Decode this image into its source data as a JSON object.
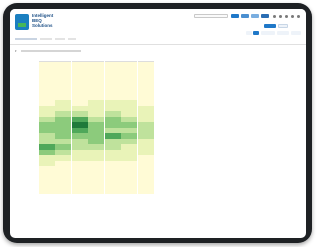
{
  "app": {
    "logo_lines": [
      "Intelligent",
      "BEQ",
      "Solutions"
    ]
  },
  "topbar": {
    "search_placeholder": "",
    "buttons": [
      {
        "label": "",
        "color": "#1f78c8"
      },
      {
        "label": "",
        "color": "#4a8fd0"
      },
      {
        "label": "",
        "color": "#7aaee0"
      },
      {
        "label": "",
        "color": "#2a6db3"
      }
    ]
  },
  "subnav": {
    "items": [
      {
        "label": ""
      },
      {
        "label": ""
      },
      {
        "label": ""
      },
      {
        "label": ""
      }
    ]
  },
  "panel": {
    "title": ""
  },
  "heatmap": {
    "columns": [
      "",
      "",
      "",
      "",
      "",
      "",
      ""
    ],
    "rows": [
      {
        "label": "",
        "values": [
          0,
          0,
          0,
          0,
          0,
          0,
          0
        ]
      },
      {
        "label": "",
        "values": [
          0,
          0,
          0,
          0,
          0,
          0,
          0
        ]
      },
      {
        "label": "",
        "values": [
          0,
          0,
          0,
          0,
          0,
          0,
          0
        ]
      },
      {
        "label": "",
        "values": [
          0,
          0,
          0,
          0,
          0,
          0,
          0
        ]
      },
      {
        "label": "",
        "values": [
          0,
          0,
          0,
          0,
          0,
          0,
          0
        ]
      },
      {
        "label": "",
        "values": [
          0,
          0,
          0,
          0,
          0,
          0,
          0
        ]
      },
      {
        "label": "",
        "values": [
          0,
          0,
          0,
          0,
          0,
          0,
          0
        ]
      },
      {
        "label": "",
        "values": [
          0,
          1,
          0,
          1,
          1,
          1,
          0
        ]
      },
      {
        "label": "",
        "values": [
          1,
          1,
          1,
          1,
          1,
          1,
          1
        ]
      },
      {
        "label": "",
        "values": [
          1,
          2,
          2,
          1,
          2,
          1,
          1
        ]
      },
      {
        "label": "",
        "values": [
          2,
          3,
          4,
          2,
          3,
          2,
          1
        ]
      },
      {
        "label": "",
        "values": [
          3,
          3,
          5,
          3,
          3,
          3,
          2
        ]
      },
      {
        "label": "",
        "values": [
          3,
          3,
          4,
          3,
          2,
          2,
          2
        ]
      },
      {
        "label": "",
        "values": [
          2,
          3,
          3,
          3,
          4,
          3,
          2
        ]
      },
      {
        "label": "",
        "values": [
          2,
          2,
          2,
          3,
          2,
          2,
          1
        ]
      },
      {
        "label": "",
        "values": [
          4,
          3,
          2,
          2,
          2,
          1,
          1
        ]
      },
      {
        "label": "",
        "values": [
          3,
          2,
          1,
          1,
          1,
          1,
          1
        ]
      },
      {
        "label": "",
        "values": [
          1,
          1,
          1,
          1,
          1,
          1,
          0
        ]
      },
      {
        "label": "",
        "values": [
          1,
          0,
          0,
          0,
          0,
          0,
          0
        ]
      },
      {
        "label": "",
        "values": [
          0,
          0,
          0,
          0,
          0,
          0,
          0
        ]
      },
      {
        "label": "",
        "values": [
          0,
          0,
          0,
          0,
          0,
          0,
          0
        ]
      },
      {
        "label": "",
        "values": [
          0,
          0,
          0,
          0,
          0,
          0,
          0
        ]
      },
      {
        "label": "",
        "values": [
          0,
          0,
          0,
          0,
          0,
          0,
          0
        ]
      },
      {
        "label": "",
        "values": [
          0,
          0,
          0,
          0,
          0,
          0,
          0
        ]
      }
    ],
    "scale": [
      "#fffbd6",
      "#e9f3b8",
      "#bfe29c",
      "#8ccb7c",
      "#4fa85a",
      "#1f7a3a"
    ]
  },
  "device": {
    "bezel_color": "#1e2124"
  }
}
